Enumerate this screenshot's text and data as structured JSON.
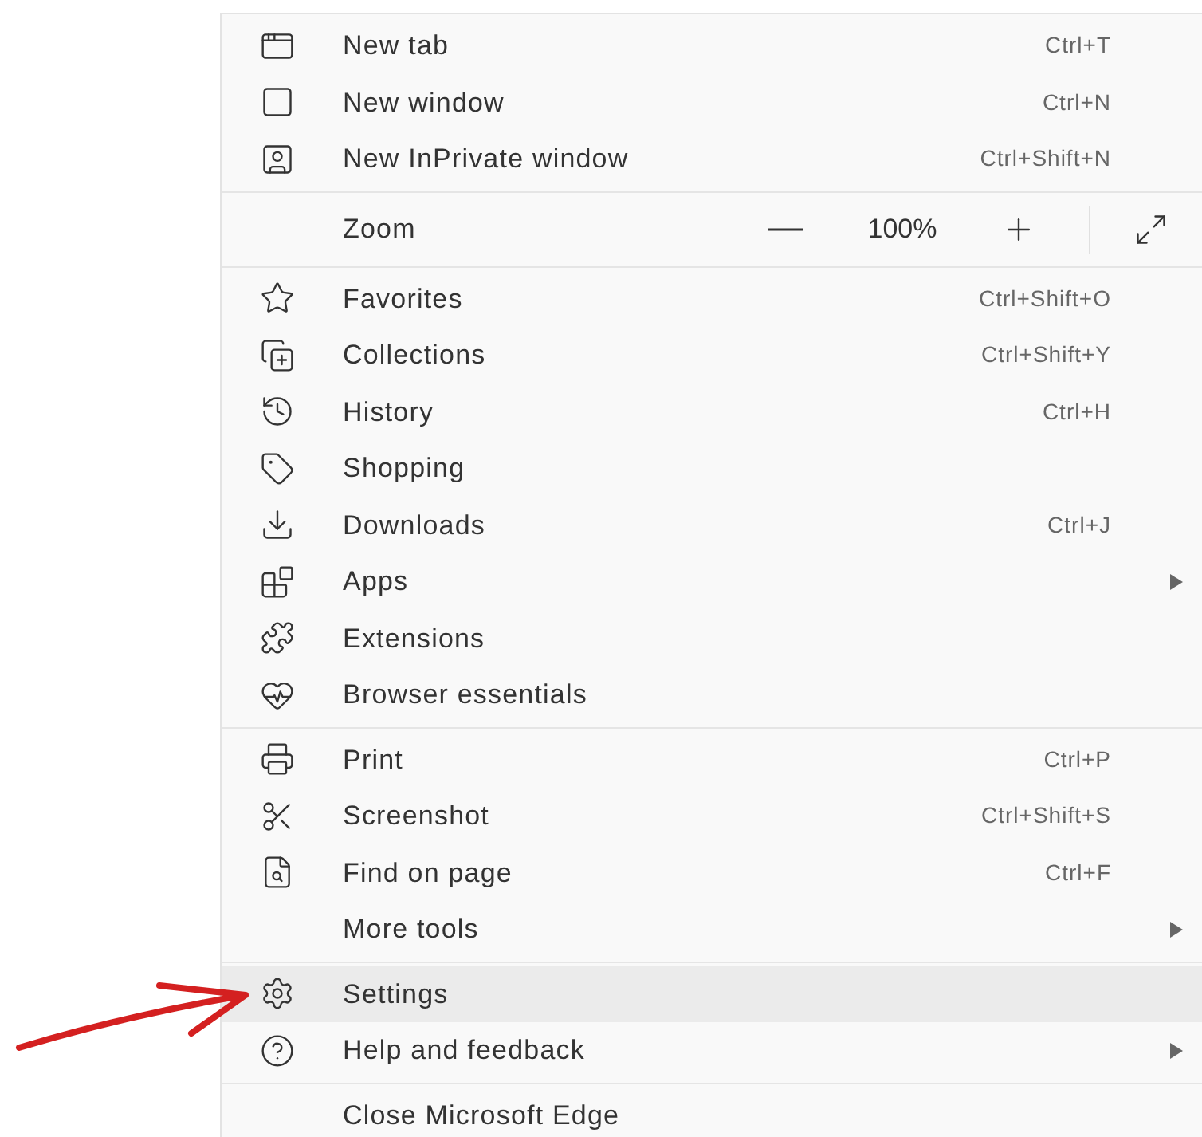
{
  "sections": [
    {
      "items": [
        {
          "kind": "item",
          "label": "New tab",
          "shortcut": "Ctrl+T",
          "submenu": false,
          "selected": false
        },
        {
          "kind": "item",
          "label": "New window",
          "shortcut": "Ctrl+N",
          "submenu": false,
          "selected": false
        },
        {
          "kind": "item",
          "label": "New InPrivate window",
          "shortcut": "Ctrl+Shift+N",
          "submenu": false,
          "selected": false
        }
      ]
    },
    {
      "items": [
        {
          "kind": "zoom",
          "label": "Zoom",
          "value": "100%"
        }
      ]
    },
    {
      "items": [
        {
          "kind": "item",
          "label": "Favorites",
          "shortcut": "Ctrl+Shift+O",
          "submenu": false,
          "selected": false
        },
        {
          "kind": "item",
          "label": "Collections",
          "shortcut": "Ctrl+Shift+Y",
          "submenu": false,
          "selected": false
        },
        {
          "kind": "item",
          "label": "History",
          "shortcut": "Ctrl+H",
          "submenu": false,
          "selected": false
        },
        {
          "kind": "item",
          "label": "Shopping",
          "submenu": false,
          "selected": false
        },
        {
          "kind": "item",
          "label": "Downloads",
          "shortcut": "Ctrl+J",
          "submenu": false,
          "selected": false
        },
        {
          "kind": "item",
          "label": "Apps",
          "submenu": true,
          "selected": false
        },
        {
          "kind": "item",
          "label": "Extensions",
          "submenu": false,
          "selected": false
        },
        {
          "kind": "item",
          "label": "Browser essentials",
          "submenu": false,
          "selected": false
        }
      ]
    },
    {
      "items": [
        {
          "kind": "item",
          "label": "Print",
          "shortcut": "Ctrl+P",
          "submenu": false,
          "selected": false
        },
        {
          "kind": "item",
          "label": "Screenshot",
          "shortcut": "Ctrl+Shift+S",
          "submenu": false,
          "selected": false
        },
        {
          "kind": "item",
          "label": "Find on page",
          "shortcut": "Ctrl+F",
          "submenu": false,
          "selected": false
        },
        {
          "kind": "item",
          "label": "More tools",
          "submenu": true,
          "selected": false
        }
      ]
    },
    {
      "items": [
        {
          "kind": "item",
          "label": "Settings",
          "submenu": false,
          "selected": true
        },
        {
          "kind": "item",
          "label": "Help and feedback",
          "submenu": true,
          "selected": false
        }
      ]
    },
    {
      "items": [
        {
          "kind": "item",
          "label": "Close Microsoft Edge",
          "submenu": false,
          "selected": false
        }
      ]
    }
  ]
}
